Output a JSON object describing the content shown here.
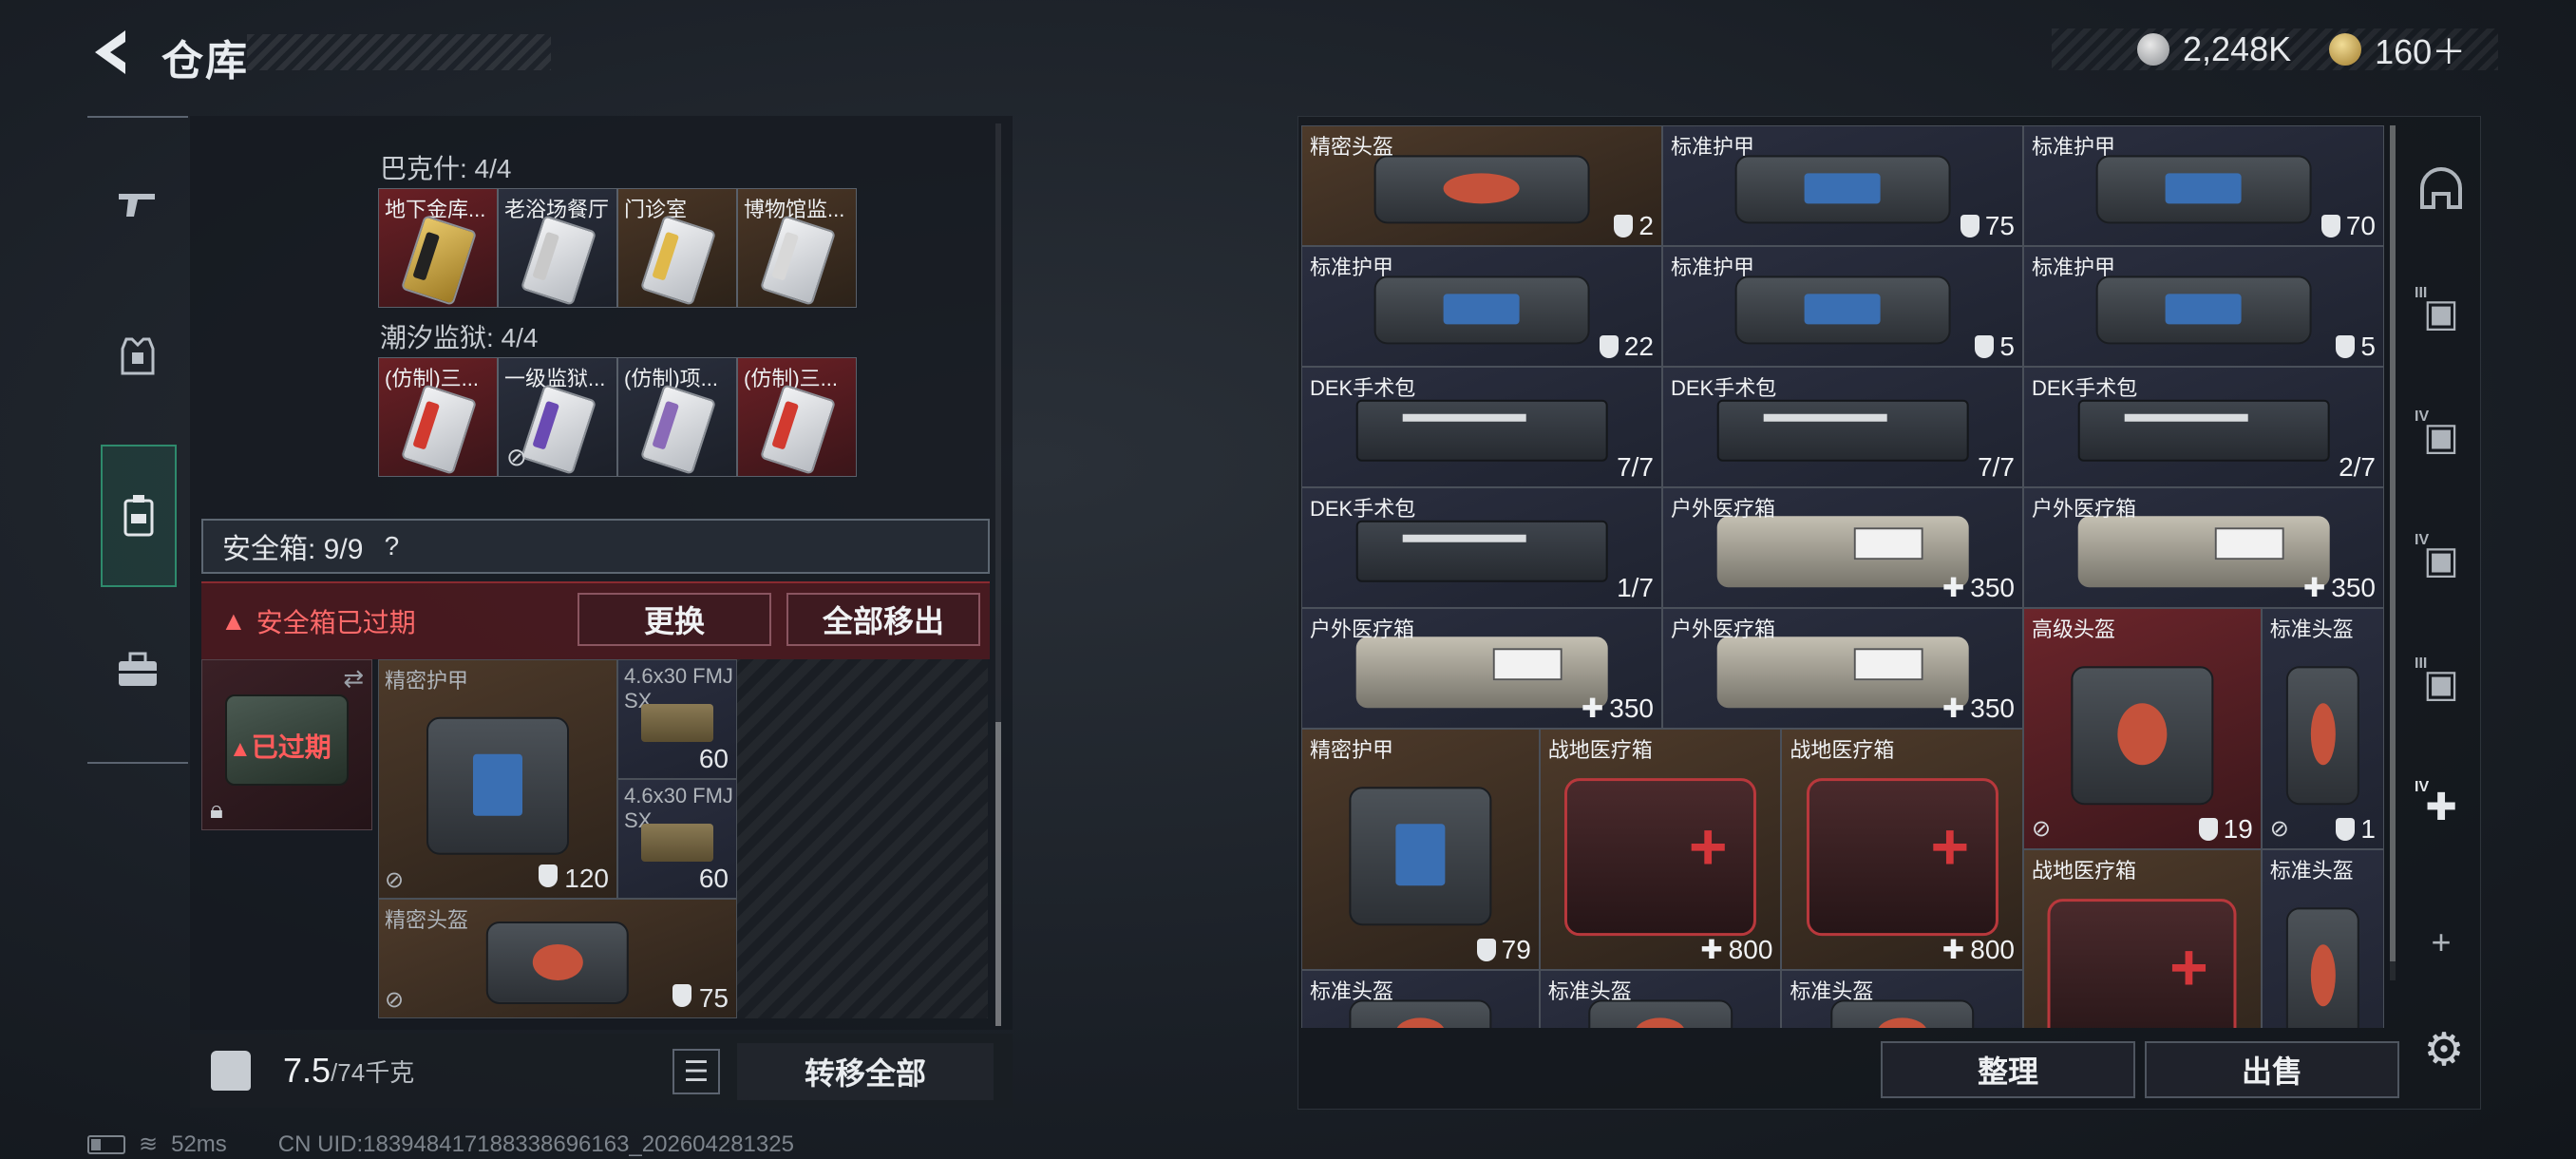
{
  "header": {
    "title": "仓库",
    "currency_silver": "2,248K",
    "currency_gold": "160＋"
  },
  "left_tabs": [
    "gun-icon",
    "armor-icon",
    "safe-box-icon",
    "toolbox-icon"
  ],
  "keys": {
    "group1_label": "巴克什: 4/4",
    "group1": [
      "地下金库...",
      "老浴场餐厅",
      "门诊室",
      "博物馆监..."
    ],
    "group2_label": "潮汐监狱: 4/4",
    "group2": [
      "(仿制)三...",
      "一级监狱...",
      "(仿制)项...",
      "(仿制)三..."
    ]
  },
  "safe_box": {
    "header": "安全箱: 9/9",
    "help": "?",
    "expired_warning": "安全箱已过期",
    "expired_tag": "已过期",
    "replace_btn": "更换",
    "move_all_btn": "全部移出",
    "items": [
      {
        "name": "精密护甲",
        "value": "120"
      },
      {
        "name": "4.6x30 FMJ SX",
        "value": "60"
      },
      {
        "name": "4.6x30 FMJ SX",
        "value": "60"
      },
      {
        "name": "精密头盔",
        "value": "75"
      }
    ]
  },
  "footer_left": {
    "weight": "7.5",
    "weight_unit": "/74千克",
    "transfer_all": "转移全部"
  },
  "status": {
    "ping": "52ms",
    "uid": "CN UID:18394841718833869616​3_202604281325"
  },
  "inventory": [
    {
      "name": "精密头盔",
      "value": "2",
      "kind": "shield"
    },
    {
      "name": "标准护甲",
      "value": "75",
      "kind": "shield"
    },
    {
      "name": "标准护甲",
      "value": "70",
      "kind": "shield"
    },
    {
      "name": "标准护甲",
      "value": "22",
      "kind": "shield"
    },
    {
      "name": "标准护甲",
      "value": "5",
      "kind": "shield"
    },
    {
      "name": "标准护甲",
      "value": "5",
      "kind": "shield"
    },
    {
      "name": "DEK手术包",
      "value": "7/7",
      "kind": "count"
    },
    {
      "name": "DEK手术包",
      "value": "7/7",
      "kind": "count"
    },
    {
      "name": "DEK手术包",
      "value": "2/7",
      "kind": "count"
    },
    {
      "name": "DEK手术包",
      "value": "1/7",
      "kind": "count"
    },
    {
      "name": "户外医疗箱",
      "value": "350",
      "kind": "plus"
    },
    {
      "name": "户外医疗箱",
      "value": "350",
      "kind": "plus"
    },
    {
      "name": "户外医疗箱",
      "value": "350",
      "kind": "plus"
    },
    {
      "name": "户外医疗箱",
      "value": "350",
      "kind": "plus"
    },
    {
      "name": "高级头盔",
      "value": "19",
      "kind": "shield"
    },
    {
      "name": "标准头盔",
      "value": "1",
      "kind": "shield"
    },
    {
      "name": "精密护甲",
      "value": "79",
      "kind": "shield"
    },
    {
      "name": "战地医疗箱",
      "value": "800",
      "kind": "plus"
    },
    {
      "name": "战地医疗箱",
      "value": "800",
      "kind": "plus"
    },
    {
      "name": "战地医疗箱",
      "value": "",
      "kind": "none"
    },
    {
      "name": "标准头盔",
      "value": "",
      "kind": "none"
    },
    {
      "name": "标准头盔",
      "value": "",
      "kind": "none"
    },
    {
      "name": "标准头盔",
      "value": "",
      "kind": "none"
    },
    {
      "name": "标准头盔",
      "value": "",
      "kind": "none"
    }
  ],
  "right_footer": {
    "sort_btn": "整理",
    "sell_btn": "出售"
  },
  "right_rail": {
    "tiers": [
      "III",
      "IV",
      "IV",
      "III",
      "IV"
    ],
    "add": "+"
  }
}
